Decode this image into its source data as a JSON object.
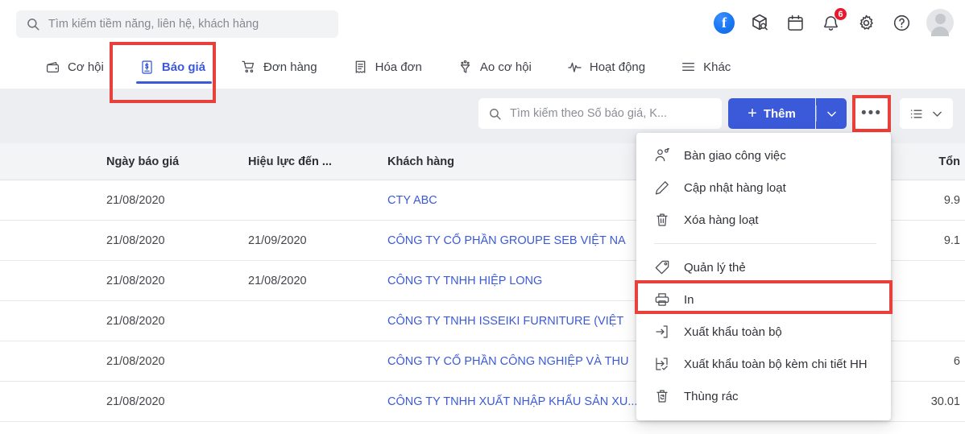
{
  "global_search": {
    "placeholder": "Tìm kiếm tiềm năng, liên hệ, khách hàng",
    "value": "",
    "icon": "search-icon"
  },
  "top_icons": [
    {
      "name": "facebook-icon",
      "glyph": "f"
    },
    {
      "name": "package-search-icon"
    },
    {
      "name": "calendar-icon"
    },
    {
      "name": "notification-bell-icon",
      "badge": "6"
    },
    {
      "name": "settings-gear-icon"
    },
    {
      "name": "help-question-icon"
    },
    {
      "name": "user-avatar"
    }
  ],
  "nav_tabs": [
    {
      "label": "Cơ hội",
      "icon": "wallet-icon",
      "active": false
    },
    {
      "label": "Báo giá",
      "icon": "quote-document-icon",
      "active": true
    },
    {
      "label": "Đơn hàng",
      "icon": "shopping-cart-icon",
      "active": false
    },
    {
      "label": "Hóa đơn",
      "icon": "invoice-icon",
      "active": false
    },
    {
      "label": "Ao cơ hội",
      "icon": "funnel-icon",
      "active": false
    },
    {
      "label": "Hoạt động",
      "icon": "activity-pulse-icon",
      "active": false
    },
    {
      "label": "Khác",
      "icon": "hamburger-menu-icon",
      "active": false
    }
  ],
  "toolbar": {
    "search_placeholder": "Tìm kiếm theo Số báo giá, K...",
    "search_value": "",
    "add_label": "Thêm",
    "add_caret_icon": "chevron-down-icon",
    "more_icon": "ellipsis-icon",
    "view_icon": "list-view-icon",
    "view_caret_icon": "chevron-down-icon"
  },
  "table": {
    "columns": [
      {
        "key": "date",
        "label": "Ngày báo giá"
      },
      {
        "key": "until",
        "label": "Hiệu lực đến ..."
      },
      {
        "key": "customer",
        "label": "Khách hàng"
      },
      {
        "key": "total",
        "label": "Tổn"
      }
    ],
    "rows": [
      {
        "date": "21/08/2020",
        "until": "",
        "customer": "CTY ABC",
        "dash": "",
        "total": "9.9"
      },
      {
        "date": "21/08/2020",
        "until": "21/09/2020",
        "customer": "CÔNG TY CỔ PHẦN GROUPE SEB VIỆT NA",
        "dash": "",
        "total": "9.1"
      },
      {
        "date": "21/08/2020",
        "until": "21/08/2020",
        "customer": "CÔNG TY TNHH HIỆP LONG",
        "dash": "",
        "total": ""
      },
      {
        "date": "21/08/2020",
        "until": "",
        "customer": "CÔNG TY TNHH ISSEIKI FURNITURE (VIỆT",
        "dash": "",
        "total": ""
      },
      {
        "date": "21/08/2020",
        "until": "",
        "customer": "CÔNG TY CỔ PHẦN CÔNG NGHIỆP VÀ THU",
        "dash": "",
        "total": "6"
      },
      {
        "date": "21/08/2020",
        "until": "",
        "customer": "CÔNG TY TNHH XUẤT NHẬP KHẨU SẢN XU...",
        "dash": "-",
        "total": "30.01"
      }
    ]
  },
  "context_menu": {
    "items": [
      {
        "label": "Bàn giao công việc",
        "icon": "user-handoff-icon",
        "highlighted": false
      },
      {
        "label": "Cập nhật hàng loạt",
        "icon": "pencil-edit-icon",
        "highlighted": false
      },
      {
        "label": "Xóa hàng loạt",
        "icon": "trash-delete-icon",
        "highlighted": false
      },
      {
        "label": "Quản lý thẻ",
        "icon": "tag-icon",
        "highlighted": false
      },
      {
        "label": "In",
        "icon": "printer-icon",
        "highlighted": true
      },
      {
        "label": "Xuất khẩu toàn bộ",
        "icon": "export-arrow-icon",
        "highlighted": false
      },
      {
        "label": "Xuất khẩu toàn bộ kèm chi tiết HH",
        "icon": "export-check-icon",
        "highlighted": false
      },
      {
        "label": "Thùng rác",
        "icon": "recycle-bin-icon",
        "highlighted": false
      }
    ],
    "separator_after_index": 2
  },
  "highlights": [
    {
      "name": "highlight-tab-baogia",
      "color": "#e8403a"
    },
    {
      "name": "highlight-more-button",
      "color": "#e8403a"
    },
    {
      "name": "highlight-print-menu-item",
      "color": "#e8403a"
    }
  ],
  "colors": {
    "accent_blue": "#3b5ad9",
    "highlight_red": "#e8403a",
    "badge_red": "#e8192c",
    "toolbar_bg": "#eceef1"
  }
}
